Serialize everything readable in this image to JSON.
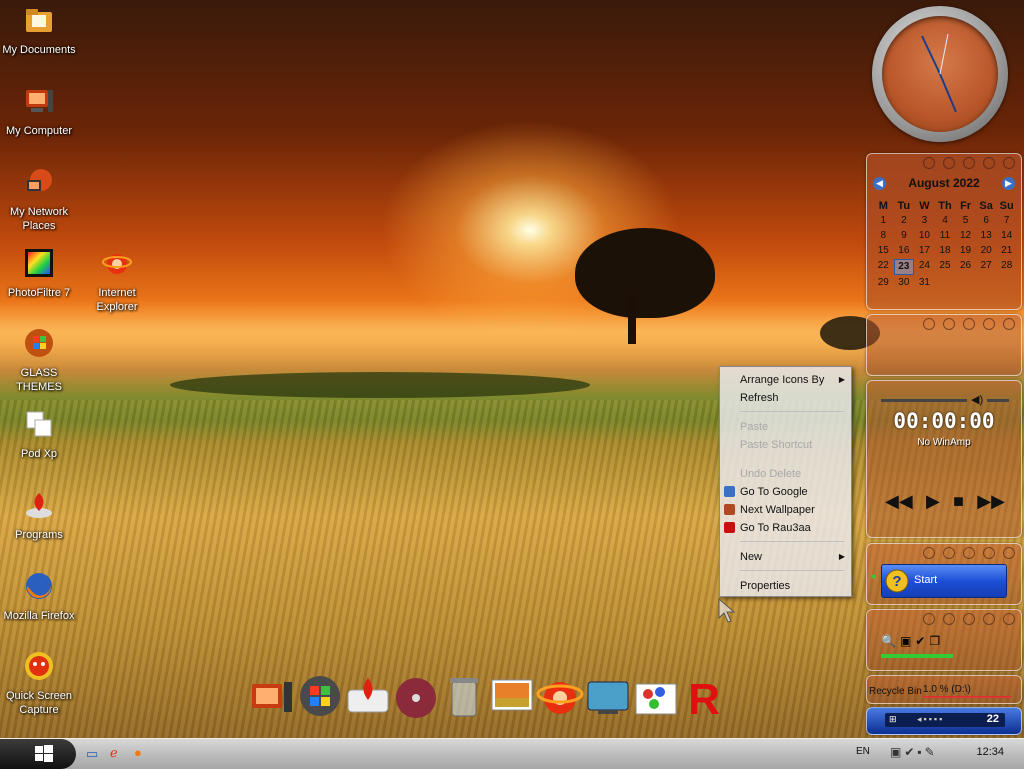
{
  "desktop_icons": [
    {
      "label_lines": [
        "My Documents"
      ],
      "icon": "folder-icon"
    },
    {
      "label_lines": [
        "My Computer"
      ],
      "icon": "computer-icon"
    },
    {
      "label_lines": [
        "My Network",
        "Places"
      ],
      "icon": "network-icon"
    },
    {
      "label_lines": [
        "PhotoFiltre 7"
      ],
      "icon": "photofiltre-icon"
    },
    {
      "label_lines": [
        "Internet",
        "Explorer"
      ],
      "icon": "internet-explorer-icon"
    },
    {
      "label_lines": [
        "GLASS",
        "THEMES"
      ],
      "icon": "windows-orb-icon"
    },
    {
      "label_lines": [
        "Pod Xp"
      ],
      "icon": "pages-icon"
    },
    {
      "label_lines": [
        "Programs"
      ],
      "icon": "programs-icon"
    },
    {
      "label_lines": [
        "Mozilla Firefox"
      ],
      "icon": "firefox-icon"
    },
    {
      "label_lines": [
        "Quick Screen",
        "Capture"
      ],
      "icon": "quick-screen-capture-icon"
    }
  ],
  "calendar": {
    "month_label": "August 2022",
    "weekdays": [
      "M",
      "Tu",
      "W",
      "Th",
      "Fr",
      "Sa",
      "Su"
    ],
    "weeks": [
      [
        "1",
        "2",
        "3",
        "4",
        "5",
        "6",
        "7"
      ],
      [
        "8",
        "9",
        "10",
        "11",
        "12",
        "13",
        "14"
      ],
      [
        "15",
        "16",
        "17",
        "18",
        "19",
        "20",
        "21"
      ],
      [
        "22",
        "23",
        "24",
        "25",
        "26",
        "27",
        "28"
      ],
      [
        "29",
        "30",
        "31",
        "",
        "",
        "",
        ""
      ]
    ],
    "today": "23"
  },
  "player": {
    "time": "00:00:00",
    "status": "No WinAmp"
  },
  "launcher": {
    "start_label": "Start"
  },
  "drive_gadget": {
    "label": "Recycle Bin",
    "usage": "1.0 % (D:\\)"
  },
  "mini_taskbar": {
    "time": "22"
  },
  "context_menu": {
    "items": [
      {
        "label": "Arrange Icons By",
        "submenu": true,
        "disabled": false
      },
      {
        "label": "Refresh",
        "submenu": false,
        "disabled": false
      },
      {
        "label": "Paste",
        "submenu": false,
        "disabled": true
      },
      {
        "label": "Paste Shortcut",
        "submenu": false,
        "disabled": true
      },
      {
        "label": "Undo Delete",
        "submenu": false,
        "disabled": true
      },
      {
        "label": "Go To Google",
        "submenu": false,
        "disabled": false,
        "icon_color": "#3a6fc4"
      },
      {
        "label": "Next Wallpaper",
        "submenu": false,
        "disabled": false,
        "icon_color": "#b04a20"
      },
      {
        "label": "Go To Rau3aa",
        "submenu": false,
        "disabled": false,
        "icon_color": "#c81010"
      },
      {
        "label": "New",
        "submenu": true,
        "disabled": false
      },
      {
        "label": "Properties",
        "submenu": false,
        "disabled": false
      }
    ]
  },
  "dock": [
    {
      "name": "dock-computer-icon"
    },
    {
      "name": "dock-windows-icon"
    },
    {
      "name": "dock-drive-icon"
    },
    {
      "name": "dock-disc-icon"
    },
    {
      "name": "dock-trash-icon"
    },
    {
      "name": "dock-pictures-icon"
    },
    {
      "name": "dock-ie-icon"
    },
    {
      "name": "dock-monitor-icon"
    },
    {
      "name": "dock-paint-icon"
    },
    {
      "name": "dock-r-icon"
    }
  ],
  "taskbar": {
    "language": "EN",
    "time": "12:34"
  },
  "colors": {
    "taskbar": "#bdbdbd",
    "start_button": "#1d4fd8",
    "calendar_today": "#2b5aa8"
  }
}
